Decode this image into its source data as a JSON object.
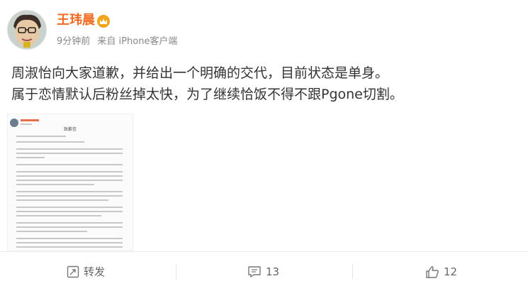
{
  "author": {
    "name": "王玮晨",
    "avatar_alt": "avatar",
    "badge_icon": "crown-icon"
  },
  "meta": {
    "time": "9分钟前",
    "source": "来自 iPhone客户端"
  },
  "post": {
    "line1": "周淑怡向大家道歉，并给出一个明确的交代，目前状态是单身。",
    "line2": "属于恋情默认后粉丝掉太快，为了继续恰饭不得不跟Pgone切割。"
  },
  "attachment": {
    "title": "致歉信",
    "type": "document-screenshot"
  },
  "actions": {
    "repost_label": "转发",
    "comment_count": "13",
    "like_count": "12"
  },
  "colors": {
    "name": "#f26a21",
    "badge": "#f4a41a",
    "meta": "#888888",
    "action_text": "#666666",
    "doc_text": "#bcbcbc"
  }
}
